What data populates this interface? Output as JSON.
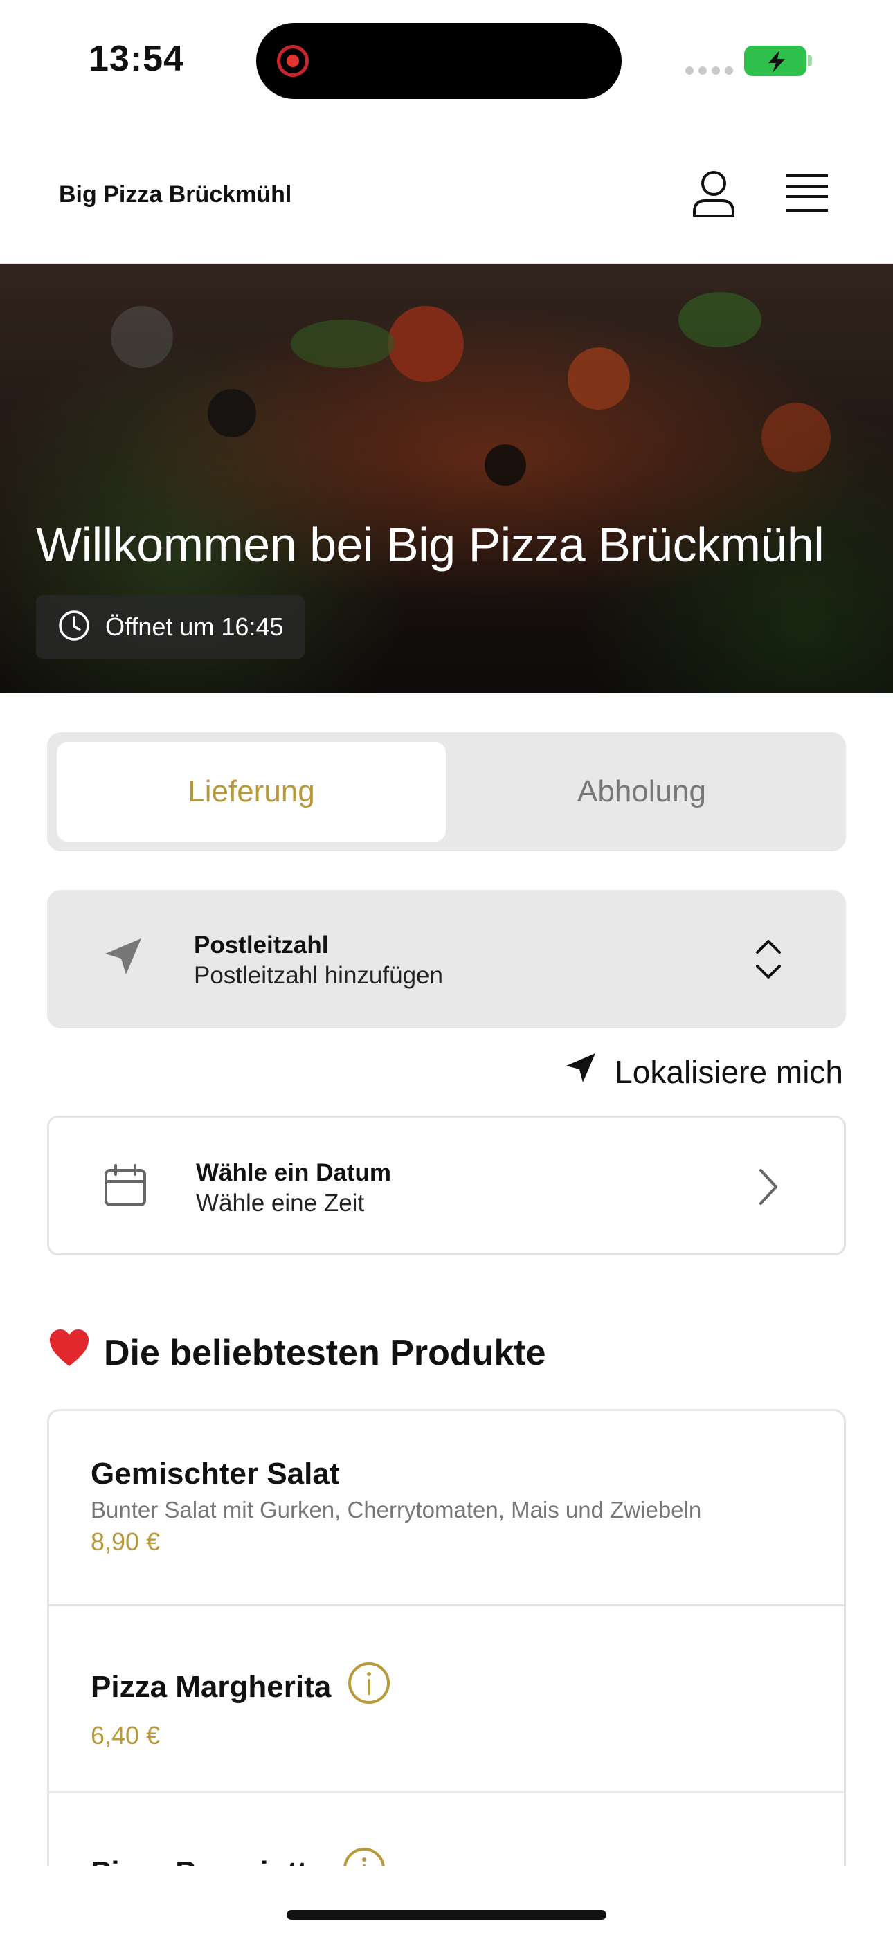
{
  "status_bar": {
    "time": "13:54"
  },
  "header": {
    "brand": "Big Pizza Brückmühl"
  },
  "hero": {
    "title": "Willkommen bei Big Pizza Brückmühl",
    "open_status": "Öffnet um 16:45"
  },
  "order_mode": {
    "options": [
      "Lieferung",
      "Abholung"
    ],
    "selected": "Lieferung"
  },
  "postal_code": {
    "label": "Postleitzahl",
    "placeholder": "Postleitzahl hinzufügen"
  },
  "locate": {
    "label": "Lokalisiere mich"
  },
  "date_picker": {
    "label": "Wähle ein Datum",
    "sublabel": "Wähle eine Zeit"
  },
  "popular": {
    "emoji": "❤️",
    "title": "Die beliebtesten Produkte",
    "items": [
      {
        "name": "Gemischter Salat",
        "description": "Bunter Salat mit Gurken, Cherrytomaten, Mais und Zwiebeln",
        "price": "8,90 €",
        "has_info": false
      },
      {
        "name": "Pizza Margherita",
        "description": "",
        "price": "6,40 €",
        "has_info": true
      },
      {
        "name": "Pizza Prosciutto",
        "description": "",
        "price": "",
        "has_info": true
      }
    ]
  },
  "colors": {
    "accent": "#b89a3b",
    "battery": "#2fbf4b",
    "recording": "#e1352f"
  }
}
